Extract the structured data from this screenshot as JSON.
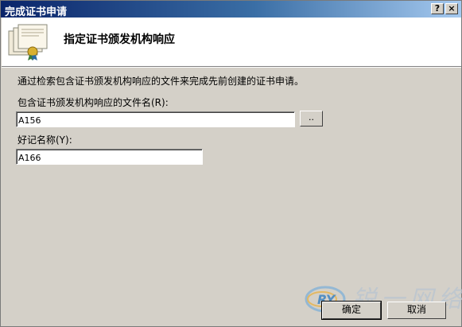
{
  "window": {
    "title": "完成证书申请",
    "help_button": "?",
    "close_button": "×"
  },
  "header": {
    "title": "指定证书颁发机构响应",
    "icon": "certificate-icon"
  },
  "form": {
    "intro_text": "通过检索包含证书颁发机构响应的文件来完成先前创建的证书申请。",
    "file_label": "包含证书颁发机构响应的文件名(R):",
    "file_value": "A156",
    "browse_label": "..",
    "friendly_label": "好记名称(Y):",
    "friendly_value": "A166"
  },
  "footer": {
    "ok_label": "确定",
    "cancel_label": "取消"
  },
  "watermark": {
    "logo_text": "RY",
    "slogan": "锐一网络"
  },
  "colors": {
    "title_start": "#0a246a",
    "title_end": "#a6caf0",
    "dialog_bg": "#d4d0c8"
  }
}
